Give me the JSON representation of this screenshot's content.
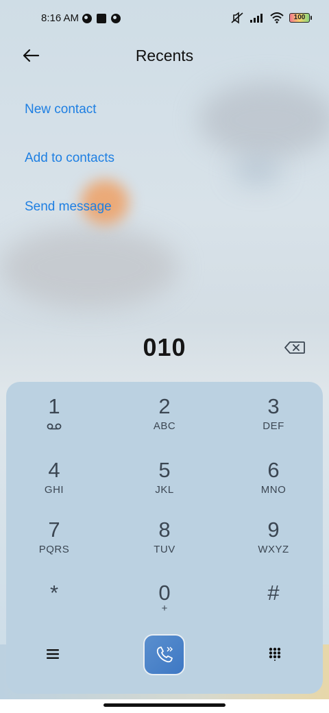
{
  "status_bar": {
    "time": "8:16 AM",
    "battery": "100",
    "icons": [
      "pie-icon",
      "square-icon",
      "pie-icon",
      "mute-icon",
      "signal-icon",
      "wifi-icon",
      "battery-icon"
    ]
  },
  "header": {
    "title": "Recents",
    "back_icon": "arrow-left-icon"
  },
  "actions": [
    {
      "label": "New contact"
    },
    {
      "label": "Add to contacts"
    },
    {
      "label": "Send message"
    }
  ],
  "dialer": {
    "number": "010",
    "backspace_icon": "backspace-icon"
  },
  "keypad": {
    "keys": [
      {
        "digit": "1",
        "letters": ""
      },
      {
        "digit": "2",
        "letters": "ABC"
      },
      {
        "digit": "3",
        "letters": "DEF"
      },
      {
        "digit": "4",
        "letters": "GHI"
      },
      {
        "digit": "5",
        "letters": "JKL"
      },
      {
        "digit": "6",
        "letters": "MNO"
      },
      {
        "digit": "7",
        "letters": "PQRS"
      },
      {
        "digit": "8",
        "letters": "TUV"
      },
      {
        "digit": "9",
        "letters": "WXYZ"
      },
      {
        "digit": "*",
        "letters": ""
      },
      {
        "digit": "0",
        "letters": "+"
      },
      {
        "digit": "#",
        "letters": ""
      }
    ],
    "bottom": {
      "menu_icon": "menu-icon",
      "call_icon": "phone-call-icon",
      "grid_icon": "keypad-grid-icon"
    }
  },
  "colors": {
    "accent": "#1e7fe2",
    "keypad_bg": "#bbd1e1",
    "call_button": "#3e78c4"
  }
}
